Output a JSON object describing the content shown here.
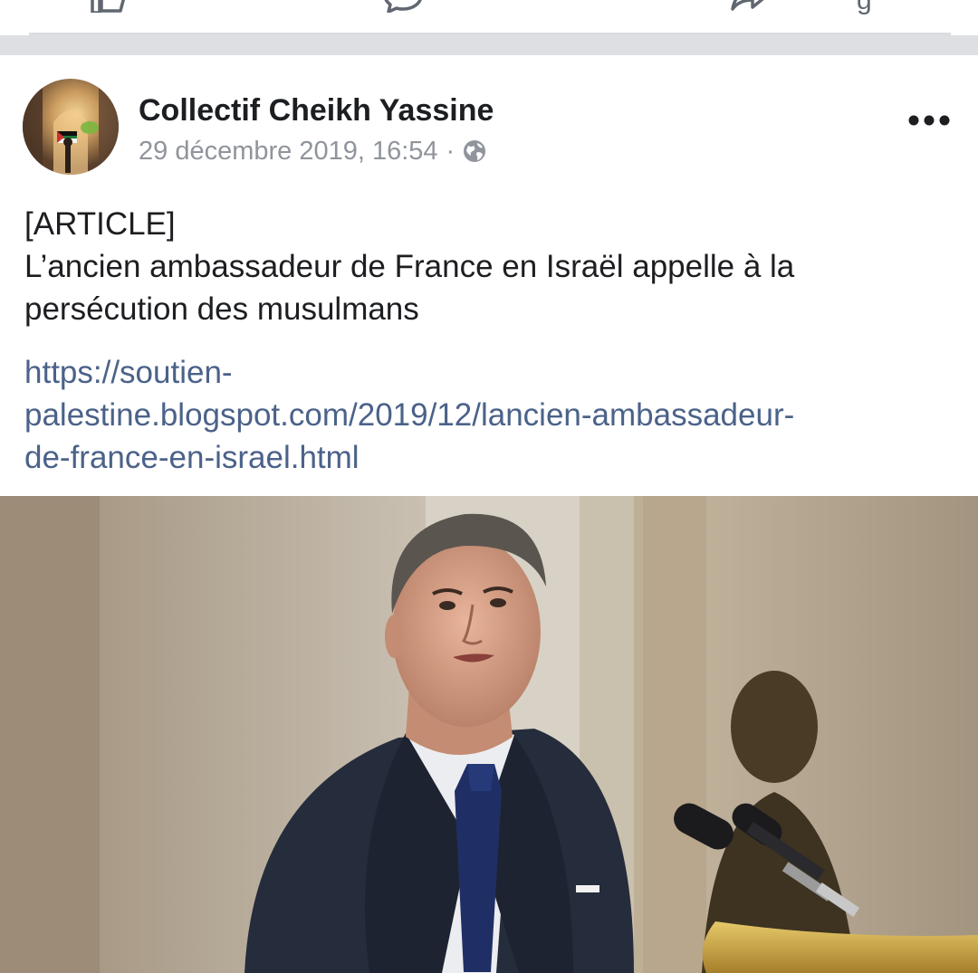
{
  "action_bar": {
    "icons": [
      "like-icon",
      "comment-icon",
      "share-icon"
    ],
    "share_label_partial": "g"
  },
  "post": {
    "author": "Collectif Cheikh Yassine",
    "timestamp": "29 décembre 2019, 16:54",
    "separator": "·",
    "privacy_icon": "globe-icon",
    "more_icon": "more-dots-icon",
    "text_lines": [
      "[ARTICLE]",
      "L’ancien ambassadeur de France en Israël appelle à la",
      "persécution des musulmans"
    ],
    "link_lines": [
      "https://soutien-",
      "palestine.blogspot.com/2019/12/lancien-ambassadeur-",
      "de-france-en-israel.html"
    ],
    "link_url": "https://soutien-palestine.blogspot.com/2019/12/lancien-ambassadeur-de-france-en-israel.html"
  },
  "colors": {
    "text": "#1c1e21",
    "meta": "#90949c",
    "link": "#4b6289",
    "feed_gap": "#dddfe2"
  }
}
